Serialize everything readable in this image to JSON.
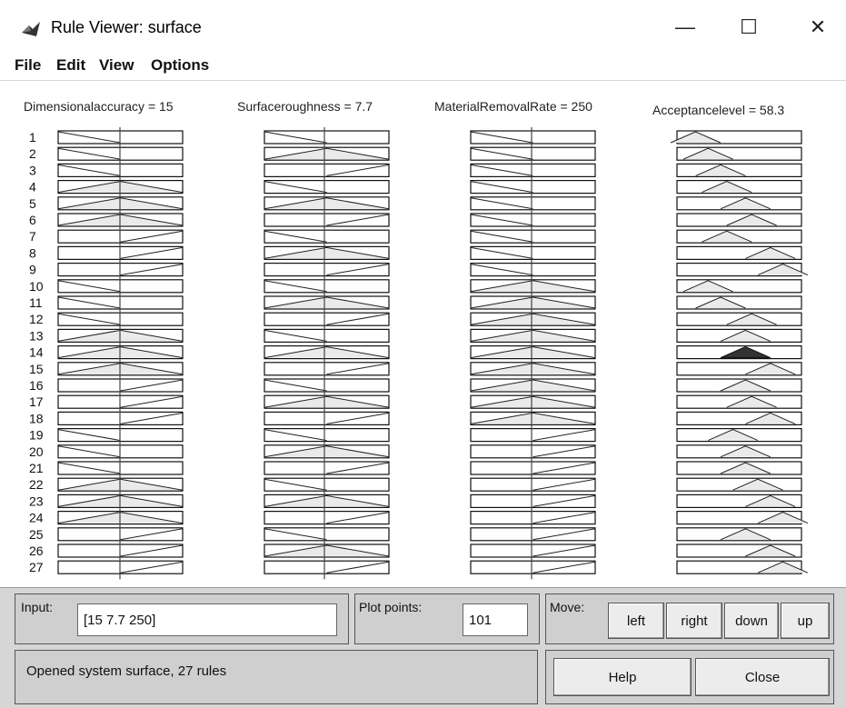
{
  "window": {
    "title": "Rule Viewer: surface",
    "minimize_icon": "minimize-icon",
    "maximize_icon": "maximize-icon",
    "close_icon": "close-icon",
    "minimize_glyph": "—",
    "maximize_glyph": "☐",
    "close_glyph": "✕"
  },
  "menu": [
    "File",
    "Edit",
    "View",
    "Options"
  ],
  "variables": [
    {
      "label": "Dimensionalaccuracy = 15"
    },
    {
      "label": "Surfaceroughness = 7.7"
    },
    {
      "label": "MaterialRemovalRate = 250"
    },
    {
      "label": "Acceptancelevel = 58.3"
    }
  ],
  "rules": {
    "count": 27,
    "row_labels": [
      "1",
      "2",
      "3",
      "4",
      "5",
      "6",
      "7",
      "8",
      "9",
      "10",
      "11",
      "12",
      "13",
      "14",
      "15",
      "16",
      "17",
      "18",
      "19",
      "20",
      "21",
      "22",
      "23",
      "24",
      "25",
      "26",
      "27"
    ],
    "input_mf": [
      [
        "L",
        "L",
        "L"
      ],
      [
        "L",
        "M",
        "L"
      ],
      [
        "L",
        "H",
        "L"
      ],
      [
        "M",
        "L",
        "L"
      ],
      [
        "M",
        "M",
        "L"
      ],
      [
        "M",
        "H",
        "L"
      ],
      [
        "H",
        "L",
        "L"
      ],
      [
        "H",
        "M",
        "L"
      ],
      [
        "H",
        "H",
        "L"
      ],
      [
        "L",
        "L",
        "M"
      ],
      [
        "L",
        "M",
        "M"
      ],
      [
        "L",
        "H",
        "M"
      ],
      [
        "M",
        "L",
        "M"
      ],
      [
        "M",
        "M",
        "M"
      ],
      [
        "M",
        "H",
        "M"
      ],
      [
        "H",
        "L",
        "M"
      ],
      [
        "H",
        "M",
        "M"
      ],
      [
        "H",
        "H",
        "M"
      ],
      [
        "L",
        "L",
        "H"
      ],
      [
        "L",
        "M",
        "H"
      ],
      [
        "L",
        "H",
        "H"
      ],
      [
        "M",
        "L",
        "H"
      ],
      [
        "M",
        "M",
        "H"
      ],
      [
        "M",
        "H",
        "H"
      ],
      [
        "H",
        "L",
        "H"
      ],
      [
        "H",
        "M",
        "H"
      ],
      [
        "H",
        "H",
        "H"
      ]
    ],
    "output_center": [
      0.15,
      0.25,
      0.35,
      0.4,
      0.55,
      0.6,
      0.4,
      0.75,
      0.85,
      0.25,
      0.35,
      0.6,
      0.55,
      0.55,
      0.75,
      0.55,
      0.6,
      0.75,
      0.45,
      0.55,
      0.55,
      0.65,
      0.75,
      0.85,
      0.55,
      0.75,
      0.85
    ],
    "output_filled_row": 14
  },
  "controls": {
    "input_label": "Input:",
    "input_value": "[15 7.7 250]",
    "plot_points_label": "Plot points:",
    "plot_points_value": "101",
    "move_label": "Move:",
    "move_buttons": [
      "left",
      "right",
      "down",
      "up"
    ],
    "status_text": "Opened system surface, 27 rules",
    "help_label": "Help",
    "close_label": "Close"
  }
}
